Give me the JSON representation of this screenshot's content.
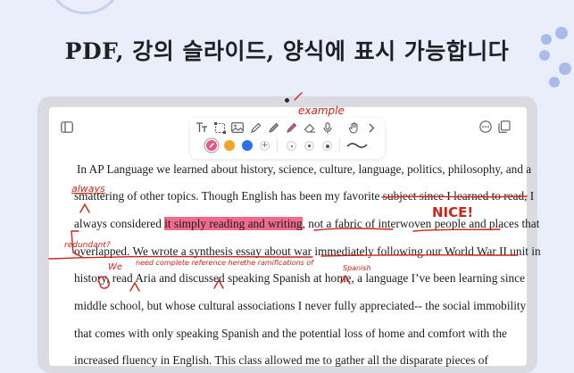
{
  "headline": "PDF, 강의 슬라이드, 양식에 표시 가능합니다",
  "toolbar": {
    "colors": {
      "pink": "#e8558a",
      "orange": "#f4a323",
      "blue": "#2f6ff0"
    },
    "icons": [
      "text-tool-icon",
      "lasso-icon",
      "image-icon",
      "pen-icon",
      "highlighter-icon",
      "marker-icon",
      "eraser-icon",
      "microphone-icon",
      "hand-icon",
      "chevron-right-icon"
    ]
  },
  "document": {
    "lines": [
      "In AP Language we learned about history, science, culture, language, politics, philosophy, and a",
      "smattering of other topics. Though English has been my favorite subject since I learned to read, I",
      "always considered",
      "it simply reading and writing",
      ", not a fabric of interwoven people and places that",
      "overlapped. We wrote a synthesis essay about war immediately following our World War II unit in",
      "history, read Aria and discussed speaking Spanish at home, a language I’ve been learning since",
      "middle school, but whose cultural associations I never fully appreciated-- the social immobility",
      "that comes with only speaking Spanish and the potential loss of home and comfort with the",
      "increased fluency in English. This class allowed me to gather all the disparate pieces of"
    ],
    "annotations": {
      "always": "always",
      "nice": "NICE!",
      "redundant": "redundant?",
      "we": "We",
      "need_ref": "need complete reference here",
      "ramifications": "the ramifications of",
      "spanish": "Spanish",
      "example": "example"
    }
  }
}
